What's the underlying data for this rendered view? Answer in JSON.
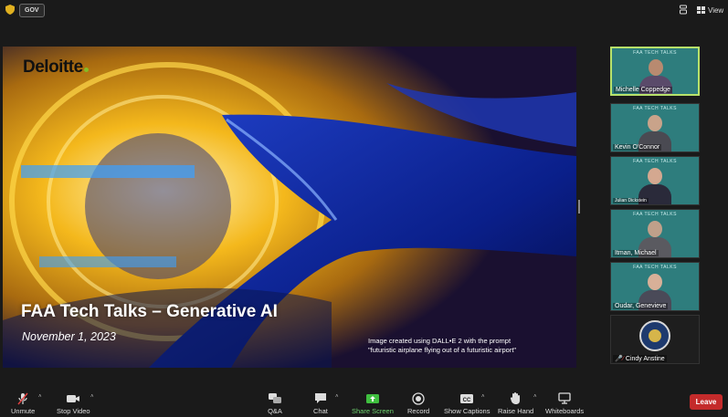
{
  "topbar": {
    "badge": "GOV",
    "view_label": "View"
  },
  "slide": {
    "logo": "Deloitte",
    "title": "FAA Tech Talks – Generative AI",
    "date": "November 1, 2023",
    "caption_line1": "Image created using DALL•E 2 with the prompt",
    "caption_line2": "\"futuristic airplane flying out of a futuristic airport\""
  },
  "participants": [
    {
      "name": "Michelle Coppedge",
      "active": true
    },
    {
      "name": "Kevin O'Connor",
      "active": false
    },
    {
      "name": "Julian Dickstein",
      "active": false
    },
    {
      "name": "Itman, Michael",
      "active": false
    },
    {
      "name": "Oudar, Genevieve",
      "active": false
    },
    {
      "name": "Cindy Anstine",
      "active": false
    }
  ],
  "tile_banner": "FAA TECH TALKS",
  "toolbar": {
    "unmute": "Unmute",
    "stop_video": "Stop Video",
    "qa": "Q&A",
    "chat": "Chat",
    "share_screen": "Share Screen",
    "record": "Record",
    "show_captions": "Show Captions",
    "raise_hand": "Raise Hand",
    "whiteboards": "Whiteboards",
    "leave": "Leave"
  },
  "colors": {
    "share_green": "#6fd26f",
    "leave_red": "#c42b2b",
    "active_speaker_border": "#b8e26a",
    "tile_teal": "#2e7d7d"
  }
}
